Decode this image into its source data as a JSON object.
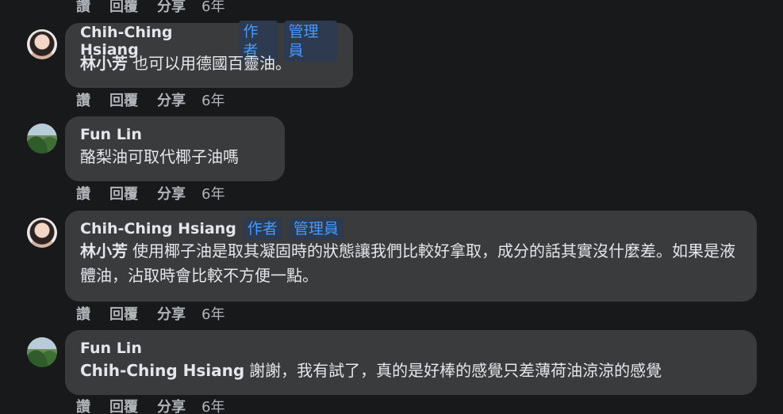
{
  "actions": {
    "like": "讚",
    "reply": "回覆",
    "share": "分享",
    "time": "6年"
  },
  "comments": [
    {
      "author": "Chih-Ching Hsiang",
      "badge_author": "作者",
      "badge_admin": "管理員",
      "mention": "林小芳",
      "text": "也可以用德國百靈油。"
    },
    {
      "author": "Fun Lin",
      "text": "酪梨油可取代椰子油嗎"
    },
    {
      "author": "Chih-Ching Hsiang",
      "badge_author": "作者",
      "badge_admin": "管理員",
      "mention": "林小芳",
      "text": "使用椰子油是取其凝固時的狀態讓我們比較好拿取，成分的話其實沒什麼差。如果是液體油，沾取時會比較不方便一點。"
    },
    {
      "author": "Fun Lin",
      "mention": "Chih-Ching Hsiang",
      "text": "謝謝，我有試了，真的是好棒的感覺只差薄荷油涼涼的感覺"
    }
  ]
}
